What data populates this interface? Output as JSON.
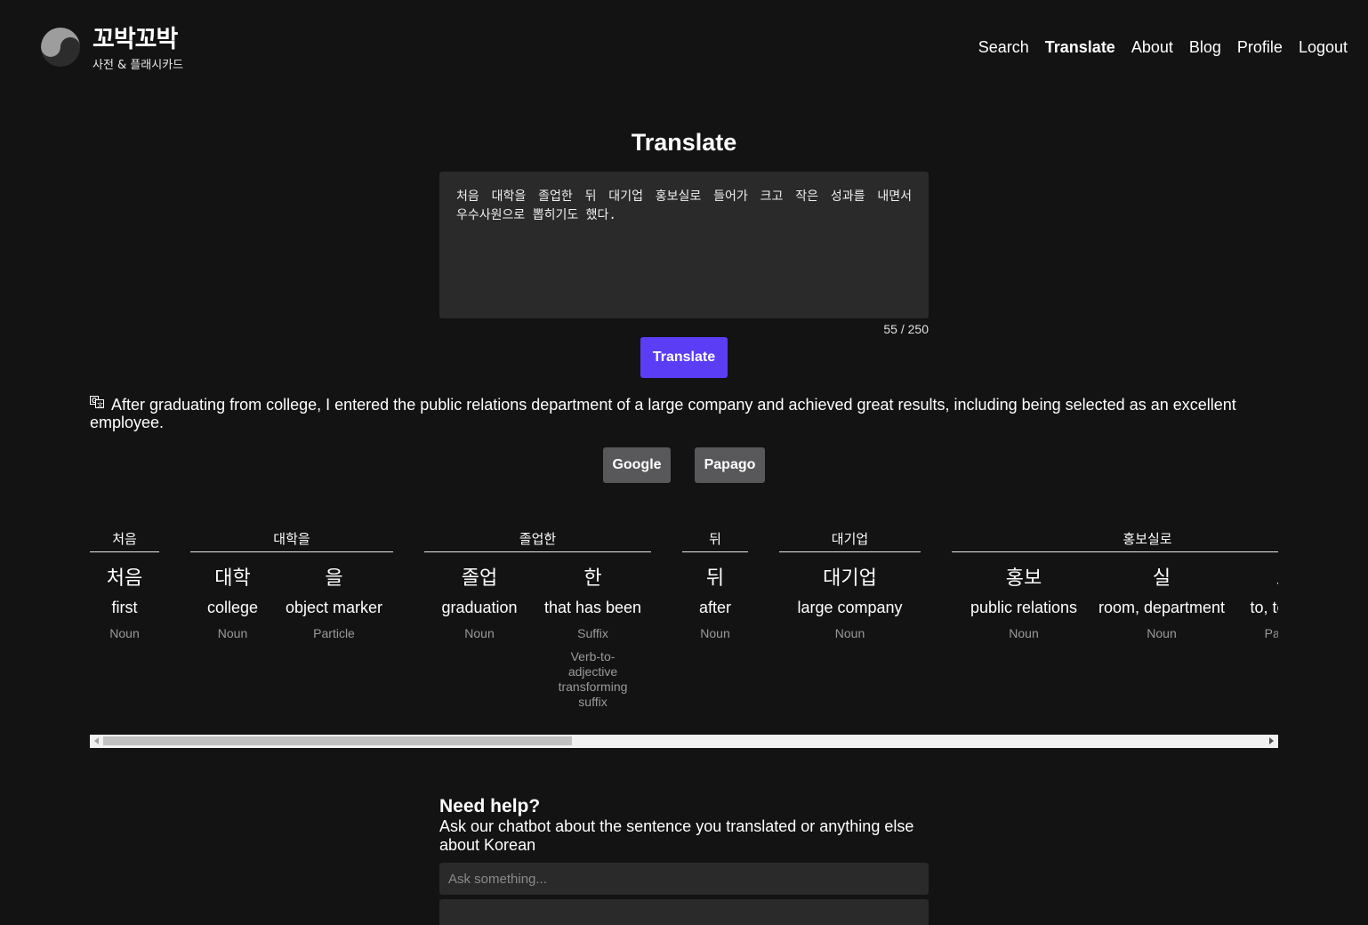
{
  "brand": {
    "title": "꼬박꼬박",
    "subtitle": "사전 & 플래시카드"
  },
  "nav": {
    "search": "Search",
    "translate": "Translate",
    "about": "About",
    "blog": "Blog",
    "profile": "Profile",
    "logout": "Logout"
  },
  "translate": {
    "title": "Translate",
    "input_text": "처음 대학을 졸업한 뒤 대기업 홍보실로 들어가 크고 작은 성과를 내면서 우수사원으로 뽑히기도 했다.",
    "char_count": "55 / 250",
    "button": "Translate",
    "result": "After graduating from college, I entered the public relations department of a large company and achieved great results, including being selected as an excellent employee.",
    "engines": {
      "google": "Google",
      "papago": "Papago"
    }
  },
  "breakdown": {
    "words": [
      {
        "word": "처음",
        "morphs": [
          {
            "kor": "처음",
            "eng": "first",
            "pos": "Noun"
          }
        ]
      },
      {
        "word": "대학을",
        "morphs": [
          {
            "kor": "대학",
            "eng": "college",
            "pos": "Noun"
          },
          {
            "kor": "을",
            "eng": "object marker",
            "pos": "Particle"
          }
        ]
      },
      {
        "word": "졸업한",
        "morphs": [
          {
            "kor": "졸업",
            "eng": "graduation",
            "pos": "Noun"
          },
          {
            "kor": "한",
            "eng": "that has been",
            "pos": "Suffix",
            "desc": "Verb-to-adjective transforming suffix"
          }
        ]
      },
      {
        "word": "뒤",
        "morphs": [
          {
            "kor": "뒤",
            "eng": "after",
            "pos": "Noun"
          }
        ]
      },
      {
        "word": "대기업",
        "morphs": [
          {
            "kor": "대기업",
            "eng": "large company",
            "pos": "Noun"
          }
        ]
      },
      {
        "word": "홍보실로",
        "morphs": [
          {
            "kor": "홍보",
            "eng": "public relations",
            "pos": "Noun"
          },
          {
            "kor": "실",
            "eng": "room, department",
            "pos": "Noun"
          },
          {
            "kor": "로",
            "eng": "to, toward",
            "pos": "Particle"
          }
        ]
      }
    ]
  },
  "help": {
    "title": "Need help?",
    "description": "Ask our chatbot about the sentence you translated or anything else about Korean",
    "placeholder": "Ask something..."
  }
}
